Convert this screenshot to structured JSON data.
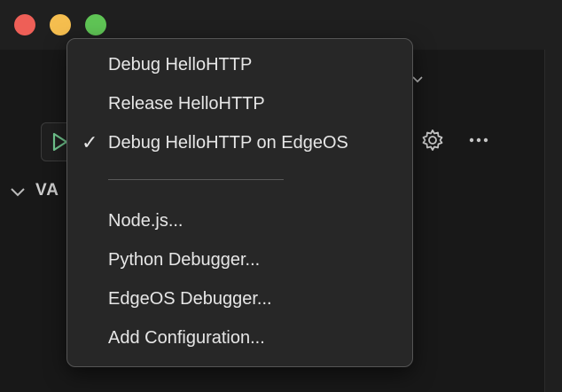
{
  "menu": {
    "items": [
      {
        "label": "Debug HelloHTTP",
        "checked": false
      },
      {
        "label": "Release HelloHTTP",
        "checked": false
      },
      {
        "label": "Debug HelloHTTP on EdgeOS",
        "checked": true
      }
    ],
    "check_glyph": "✓",
    "items_after_separator": [
      {
        "label": "Node.js..."
      },
      {
        "label": "Python Debugger..."
      },
      {
        "label": "EdgeOS Debugger..."
      },
      {
        "label": "Add Configuration..."
      }
    ]
  },
  "sidebar": {
    "section_title": "VA"
  },
  "icons": {
    "run": "play-icon",
    "settings": "gear-icon",
    "more": "more-icon",
    "section": "chevron-down-icon"
  },
  "colors": {
    "close": "#ee5f57",
    "minimize": "#f5be4f",
    "zoom": "#5fc455",
    "run_accent": "#73c991"
  }
}
